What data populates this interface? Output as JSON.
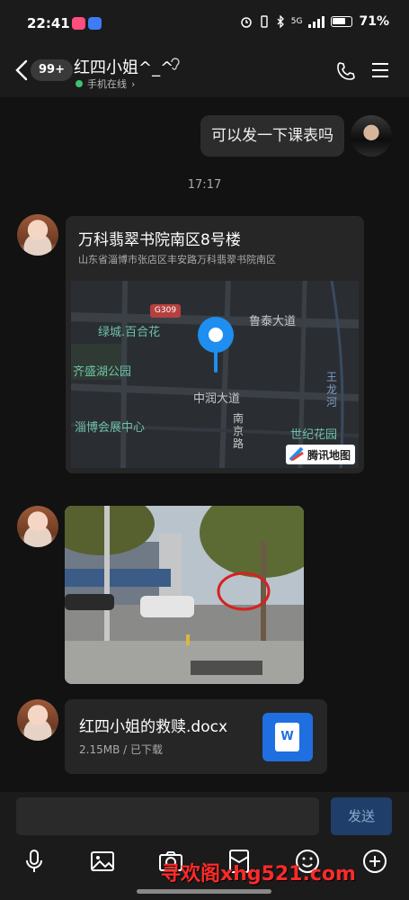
{
  "status_bar": {
    "time": "22:41",
    "signal_label": "5G",
    "battery": "71%"
  },
  "header": {
    "unread_badge": "99+",
    "title": "红四小姐^_^",
    "online_status": "手机在线",
    "online_chevron": "›",
    "icons": [
      "back-icon",
      "ear-icon",
      "phone-icon",
      "menu-icon"
    ]
  },
  "messages": {
    "outgoing_text": "可以发一下课表吗",
    "timestamp": "17:17",
    "location": {
      "title": "万科翡翠书院南区8号楼",
      "address": "山东省淄博市张店区丰安路万科翡翠书院南区",
      "map_labels": {
        "road_code": "G309",
        "lvcheng": "绿城.百合花",
        "lutai": "鲁泰大道",
        "qisheng": "齐盛湖公园",
        "zhongrun": "中润大道",
        "wanglong": "王龙河",
        "zibo_expo": "淄博会展中心",
        "nanjing_road": "南京路",
        "century_garden": "世纪花园"
      },
      "map_provider": "腾讯地图"
    },
    "file": {
      "name": "红四小姐的救赎.docx",
      "meta": "2.15MB / 已下载",
      "icon_letter": "W"
    }
  },
  "input_bar": {
    "placeholder": "",
    "send_label": "发送"
  },
  "toolbar": [
    "mic-icon",
    "image-icon",
    "camera-icon",
    "red-packet-icon",
    "emoji-icon",
    "plus-icon"
  ],
  "watermark": "寻欢阁xhg521.com",
  "colors": {
    "accent_blue": "#1f3e6a",
    "online_green": "#3ec46d",
    "watermark_red": "#ff2a2a",
    "word_blue": "#1f6fe0"
  }
}
